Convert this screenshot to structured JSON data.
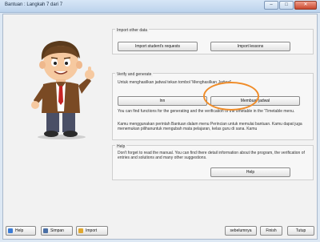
{
  "window": {
    "title": "Bantuan : Langkah 7 dari 7",
    "minimize": "–",
    "maximize": "□",
    "close": "✕"
  },
  "import_section": {
    "title": "Import other data",
    "import_students_label": "Import student's requests",
    "import_lessons_label": "Import lessons"
  },
  "verify_section": {
    "title": "Verify and generate",
    "instruction": "Untuk menghasilkan jadwal tekan tombol 'Menghasilkan Jadwal'",
    "small_button_label": "lnn",
    "generate_label": "Membuat jadwal",
    "info_text": "You can find functions for the generating and the verification of the timetable in the 'Timetable menu.",
    "help_text": "Kamu menggunakan perintah Bantuan dalam menu Perincian untuk memulai bantuan. Kamu dapat juga menemukan pilihanuntuk mengubah mata pelajaran,  kelas guru di sana. Kamu"
  },
  "help_section": {
    "title": "Help",
    "text": "Don't forget to read the manual. You can find there detail information about the program, the verification of entries and solutions and many other suggestions.",
    "help_label": "Help"
  },
  "footer": {
    "help_label": "Help",
    "save_label": "Simpan",
    "import_label": "Import",
    "back_label": "sebelumnya",
    "finish_label": "Finish",
    "close_label": "Tutup"
  },
  "colors": {
    "highlight": "#f08c28",
    "title_bar": "#c9dcf0"
  }
}
